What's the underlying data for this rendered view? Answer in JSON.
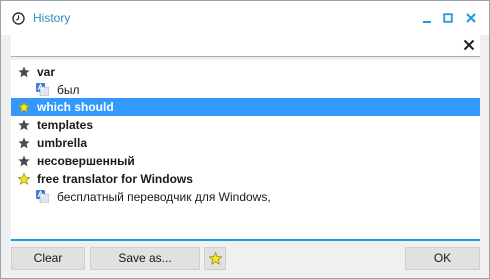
{
  "window": {
    "title": "History",
    "icons": {
      "title": "clock-icon",
      "minimize": "minimize-icon",
      "maximize": "maximize-icon",
      "close": "close-icon"
    }
  },
  "search": {
    "value": "",
    "placeholder": "",
    "clear_icon": "close-icon"
  },
  "history": {
    "items": [
      {
        "type": "entry",
        "text": "var",
        "icon": "star-icon",
        "favorite": false,
        "selected": false
      },
      {
        "type": "translation",
        "text": "был",
        "icon": "translate-icon"
      },
      {
        "type": "entry",
        "text": "which should",
        "icon": "star-icon",
        "favorite": true,
        "selected": true
      },
      {
        "type": "entry",
        "text": "templates",
        "icon": "star-icon",
        "favorite": false,
        "selected": false
      },
      {
        "type": "entry",
        "text": "umbrella",
        "icon": "star-icon",
        "favorite": false,
        "selected": false
      },
      {
        "type": "entry",
        "text": "несовершенный",
        "icon": "star-icon",
        "favorite": false,
        "selected": false
      },
      {
        "type": "entry",
        "text": "free translator for Windows",
        "icon": "star-icon",
        "favorite": true,
        "selected": false
      },
      {
        "type": "translation",
        "text": "бесплатный переводчик для Windows,",
        "icon": "translate-icon"
      }
    ]
  },
  "buttons": {
    "clear": "Clear",
    "save_as": "Save as...",
    "favorites_icon": "star-icon",
    "ok": "OK"
  },
  "colors": {
    "accent": "#2b8fbf",
    "selection": "#3399ff",
    "favorite_star": "#f2e51a",
    "plain_star": "#4a4a4a",
    "list_border": "#1e9be0"
  }
}
